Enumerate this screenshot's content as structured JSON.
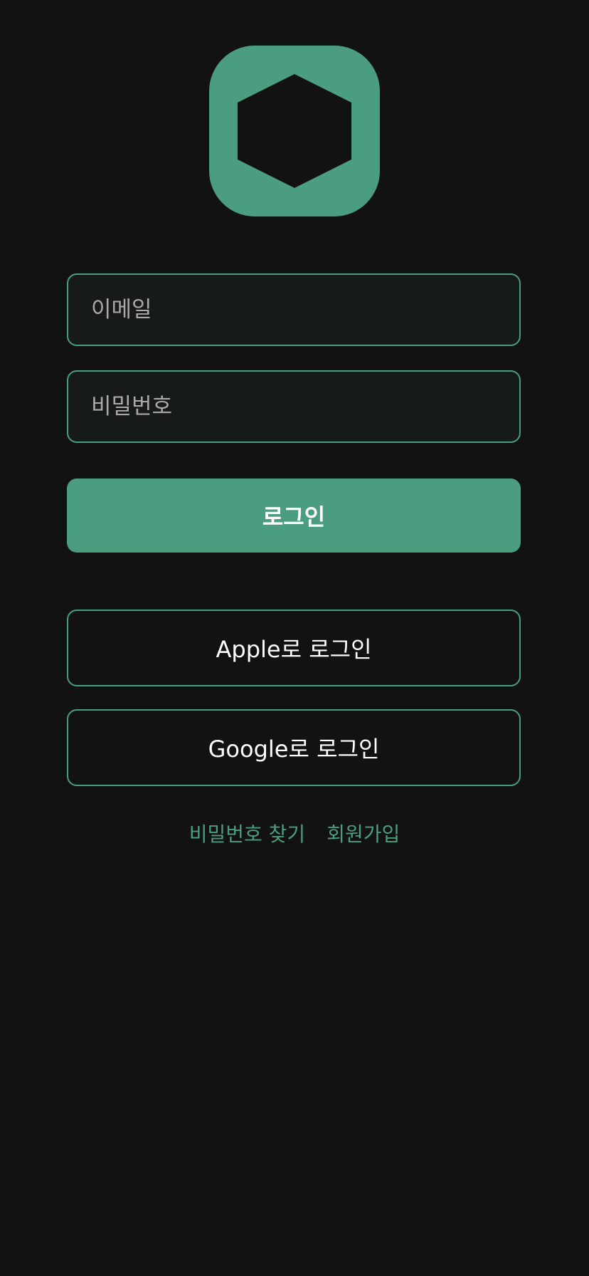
{
  "logo": {
    "icon": "hexagon-icon",
    "color": "#4a9e7f"
  },
  "form": {
    "email_placeholder": "이메일",
    "password_placeholder": "비밀번호",
    "login_label": "로그인"
  },
  "social": {
    "apple_label": "Apple로 로그인",
    "google_label": "Google로 로그인"
  },
  "links": {
    "find_password": "비밀번호 찾기",
    "signup": "회원가입"
  },
  "colors": {
    "background": "#121212",
    "accent": "#4a9e7f",
    "field_background": "#161a19",
    "text": "#ffffff"
  }
}
